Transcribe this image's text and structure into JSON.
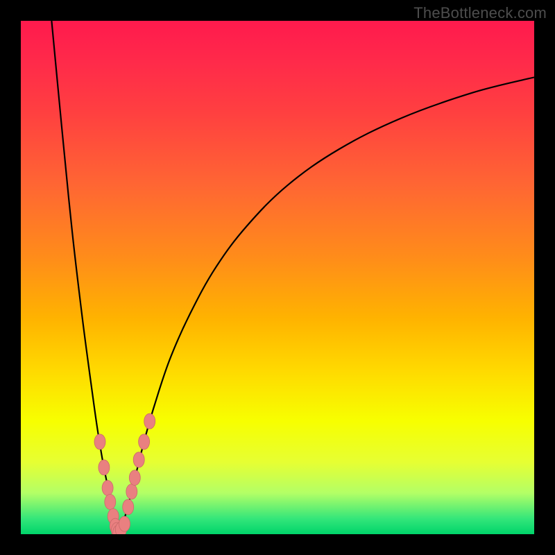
{
  "watermark": "TheBottleneck.com",
  "colors": {
    "frame": "#000000",
    "curve": "#000000",
    "marker_fill": "#e98080",
    "marker_stroke": "#c96a6a"
  },
  "chart_data": {
    "type": "line",
    "title": "",
    "xlabel": "",
    "ylabel": "",
    "xlim": [
      0,
      100
    ],
    "ylim": [
      0,
      100
    ],
    "note": "Black curve shows a V-shaped function dropping to ~0 near x≈19, with a slower rising right branch. Coral markers cluster near the minimum on both branches.",
    "series": [
      {
        "name": "curve-left",
        "x": [
          6,
          8,
          10,
          12,
          14,
          15,
          16,
          17,
          18,
          18.6,
          19
        ],
        "y": [
          100,
          79,
          59,
          42,
          27,
          20,
          14,
          9,
          4.5,
          1.5,
          0
        ]
      },
      {
        "name": "curve-right",
        "x": [
          19,
          20,
          21,
          22,
          24,
          26,
          29,
          33,
          38,
          44,
          52,
          62,
          74,
          88,
          100
        ],
        "y": [
          0,
          2.5,
          6,
          10,
          18,
          25,
          34,
          43,
          52,
          60,
          68,
          75,
          81,
          86,
          89
        ]
      },
      {
        "name": "markers-left",
        "x": [
          15.4,
          16.2,
          16.9,
          17.4,
          18.0,
          18.4
        ],
        "y": [
          18.0,
          13.0,
          9.0,
          6.3,
          3.5,
          1.6
        ]
      },
      {
        "name": "markers-bottom",
        "x": [
          18.7,
          19.0,
          19.5,
          20.2
        ],
        "y": [
          0.8,
          0.3,
          0.9,
          2.0
        ]
      },
      {
        "name": "markers-right",
        "x": [
          20.9,
          21.6,
          22.2,
          23.0,
          24.0,
          25.1
        ],
        "y": [
          5.3,
          8.3,
          11.0,
          14.5,
          18.0,
          22.0
        ]
      }
    ]
  }
}
